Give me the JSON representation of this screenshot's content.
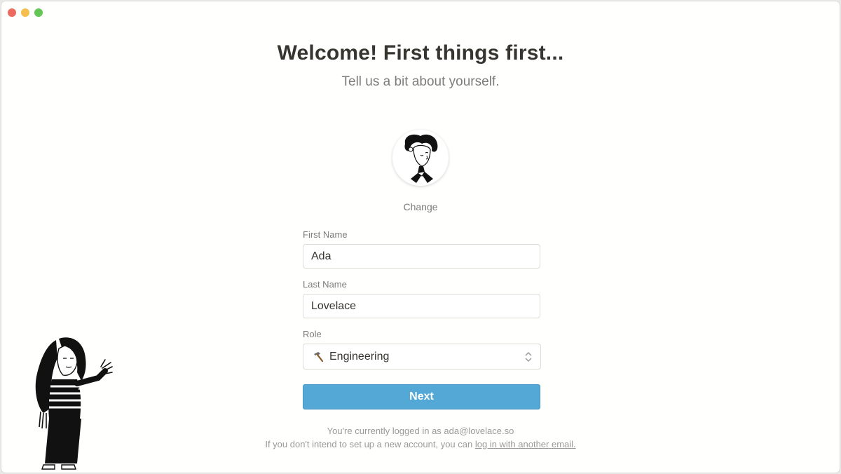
{
  "window": {
    "controls": [
      "close",
      "minimize",
      "zoom"
    ]
  },
  "header": {
    "title": "Welcome! First things first...",
    "subtitle": "Tell us a bit about yourself."
  },
  "avatar": {
    "icon": "portrait-icon",
    "change_label": "Change"
  },
  "form": {
    "first_name_label": "First Name",
    "first_name_value": "Ada",
    "last_name_label": "Last Name",
    "last_name_value": "Lovelace",
    "role_label": "Role",
    "role_icon": "hammer-icon",
    "role_value": "Engineering",
    "next_label": "Next"
  },
  "footer": {
    "logged_in_text": "You're currently logged in as ada@lovelace.so",
    "intent_text": "If you don't intend to set up a new account, you can ",
    "link_text": "log in with another email."
  },
  "colors": {
    "accent": "#53a8d6",
    "text": "#37352f",
    "muted": "#7d7c78"
  }
}
